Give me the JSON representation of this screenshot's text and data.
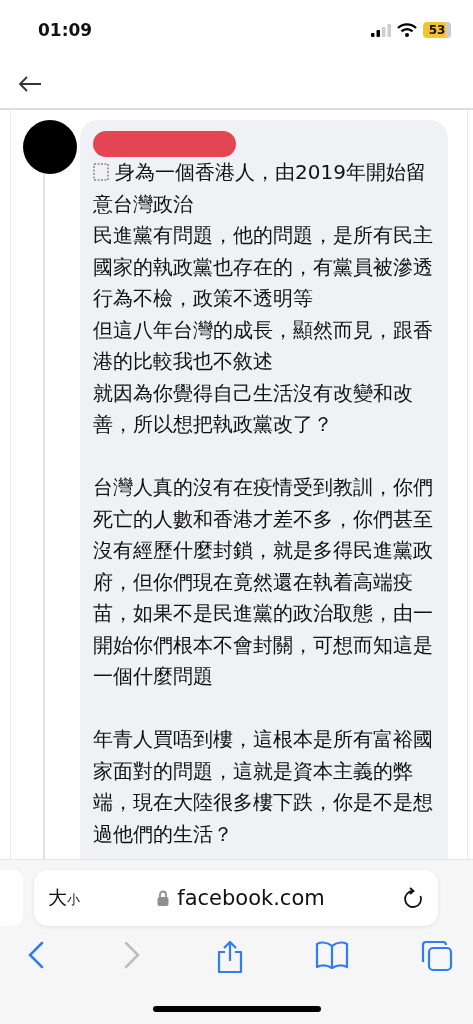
{
  "status_bar": {
    "time": "01:09",
    "battery": "53"
  },
  "comment": {
    "paragraphs": [
      {
        "lines": [
          "身為一個香港人，由2019年開始留",
          "意台灣政治",
          "民進黨有問題，他的問題，是所有民主",
          "國家的執政黨也存在的，有黨員被滲透",
          "行為不檢，政策不透明等",
          "但這八年台灣的成長，顯然而見，跟香",
          "港的比較我也不敘述",
          "就因為你覺得自己生活沒有改變和改",
          "善，所以想把執政黨改了？"
        ]
      },
      {
        "lines": [
          "台灣人真的沒有在疫情受到教訓，你們",
          "死亡的人數和香港才差不多，你們甚至",
          "沒有經歷什麼封鎖，就是多得民進黨政",
          "府，但你們現在竟然還在執着高端疫",
          "苗，如果不是民進黨的政治取態，由一",
          "開始你們根本不會封關，可想而知這是",
          "一個什麼問題"
        ]
      },
      {
        "lines": [
          "年青人買唔到樓，這根本是所有富裕國",
          "家面對的問題，這就是資本主義的弊",
          "端，現在大陸很多樓下跌，你是不是想",
          "過他們的生活？"
        ]
      }
    ]
  },
  "address_bar": {
    "text_size_big": "大",
    "text_size_small": "小",
    "url": "facebook.com"
  },
  "toolbar": [
    {
      "kind": "back",
      "disabled": false
    },
    {
      "kind": "forward",
      "disabled": true
    },
    {
      "kind": "share",
      "disabled": false
    },
    {
      "kind": "bookmarks",
      "disabled": false
    },
    {
      "kind": "tabs",
      "disabled": false
    }
  ]
}
